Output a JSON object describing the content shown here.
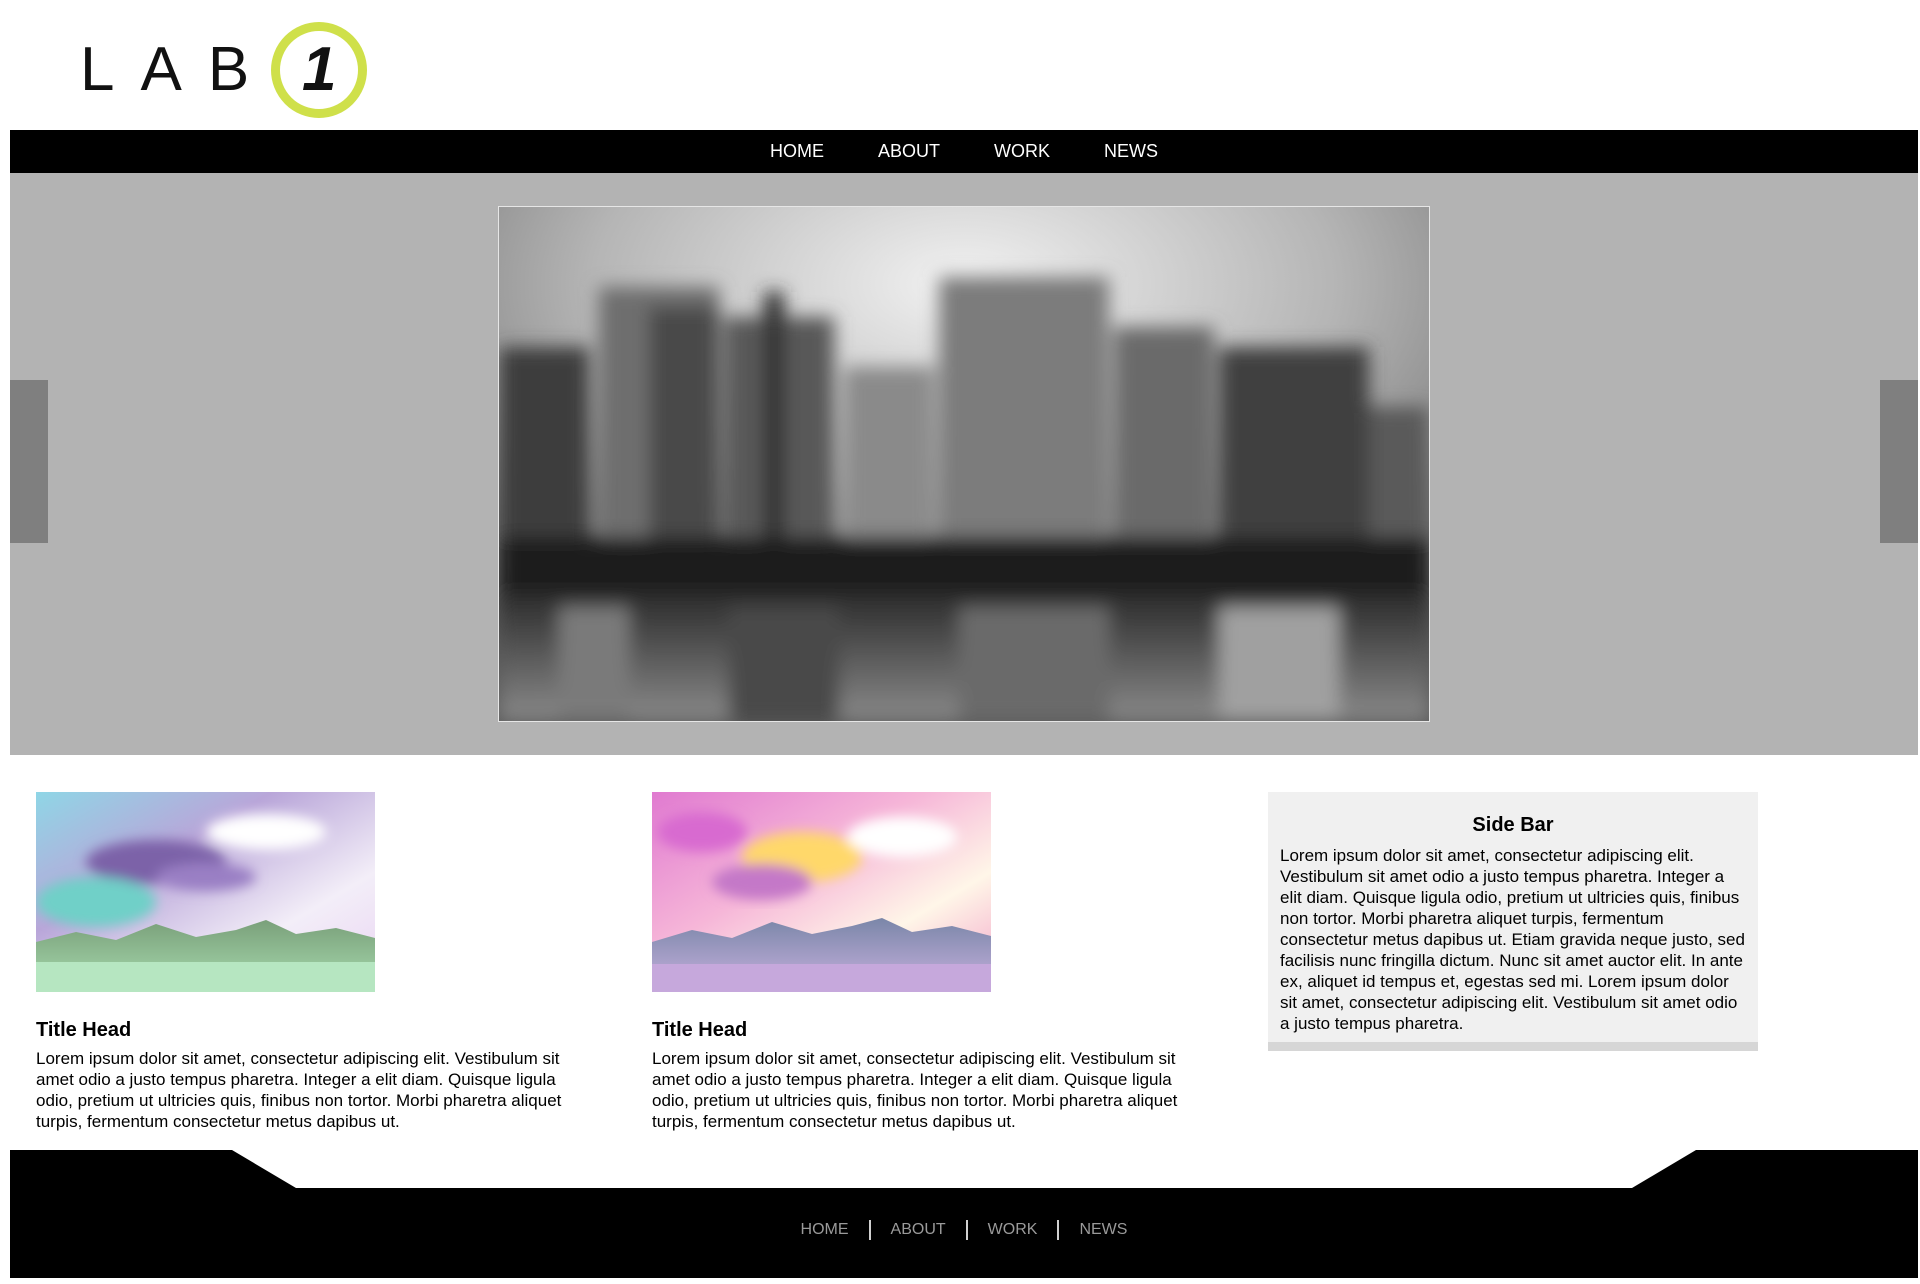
{
  "brand": {
    "logo_text": "LAB",
    "logo_number": "1",
    "accent_color": "#cfe04a"
  },
  "nav": {
    "items": [
      {
        "label": "HOME"
      },
      {
        "label": "ABOUT"
      },
      {
        "label": "WORK"
      },
      {
        "label": "NEWS"
      }
    ]
  },
  "articles": [
    {
      "title": "Title Head",
      "body": "Lorem ipsum dolor sit amet, consectetur adipiscing elit. Vestibulum sit amet odio a justo tempus pharetra. Integer a elit diam. Quisque ligula odio, pretium ut ultricies quis, finibus non tortor. Morbi pharetra aliquet turpis, fermentum consectetur metus dapibus ut."
    },
    {
      "title": "Title Head",
      "body": "Lorem ipsum dolor sit amet, consectetur adipiscing elit. Vestibulum sit amet odio a justo tempus pharetra. Integer a elit diam. Quisque ligula odio, pretium ut ultricies quis, finibus non tortor. Morbi pharetra aliquet turpis, fermentum consectetur metus dapibus ut."
    }
  ],
  "sidebar": {
    "title": "Side Bar",
    "body": "Lorem ipsum dolor sit amet, consectetur adipiscing elit. Vestibulum sit amet odio a justo tempus pharetra. Integer a elit diam. Quisque ligula odio, pretium ut ultricies quis, finibus non tortor. Morbi pharetra aliquet turpis, fermentum consectetur metus dapibus ut. Etiam gravida neque justo, sed facilisis nunc fringilla dictum. Nunc sit amet auctor elit. In ante ex, aliquet id tempus et, egestas sed mi. Lorem ipsum dolor sit amet, consectetur adipiscing elit. Vestibulum sit amet odio a justo tempus pharetra."
  },
  "footer": {
    "nav": [
      {
        "label": "HOME"
      },
      {
        "label": "ABOUT"
      },
      {
        "label": "WORK"
      },
      {
        "label": "NEWS"
      }
    ]
  }
}
